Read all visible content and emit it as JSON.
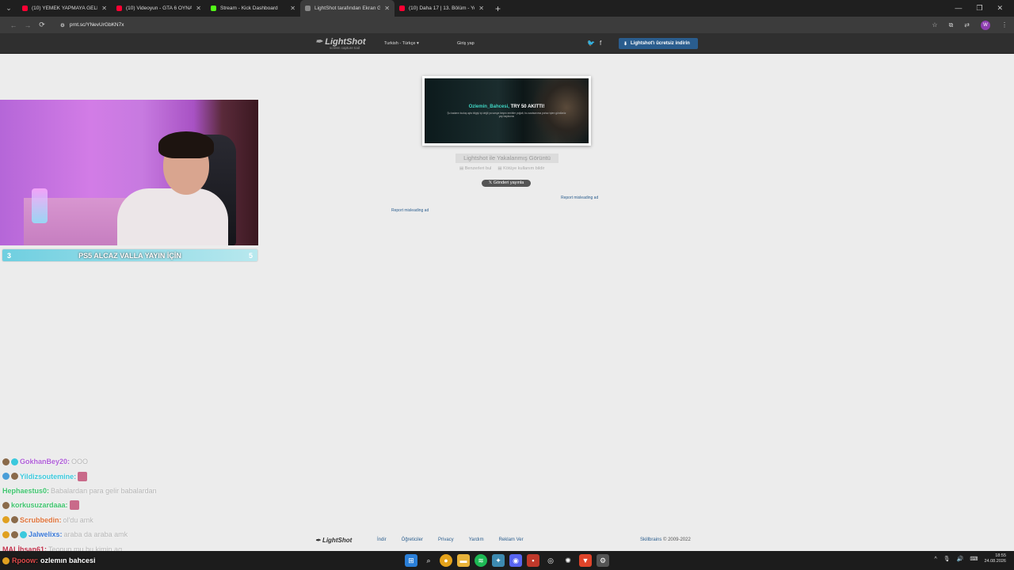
{
  "browser": {
    "tabs": [
      {
        "label": "(10) YEMEK YAPMAYA GELDİK...",
        "color": "#ff0033",
        "active": false
      },
      {
        "label": "(10) Videoyun - GTA 6 OYNANI...",
        "color": "#ff0033",
        "active": false
      },
      {
        "label": "Stream - Kick Dashboard",
        "color": "#53fc18",
        "active": false
      },
      {
        "label": "LightShot tarafından Ekran Gö...",
        "color": "#888888",
        "active": true
      },
      {
        "label": "(10) Daha 17 | 13. Bölüm - YouT...",
        "color": "#ff0033",
        "active": false
      }
    ],
    "url": "prnt.sc/YNevUrGbKN7x",
    "profile_initial": "W"
  },
  "lightshot": {
    "logo": "LightShot",
    "logo_sub": "screen capture tool",
    "language": "Turkish - Türkçe",
    "login": "Giriş yap",
    "download_button": "Lightshot'ı ücretsiz indirin",
    "screenshot": {
      "title_name": "Ozlemin_Bahcesi,",
      "title_rest": " TRY 50 AKITTI!",
      "text": "Şu kadarın kuduş ayla bilgiyi içi değil ya sarıya beşmı emiriler yoğalt, bu azatsanıma yurtaz işten gördünüz yay bayksırısı"
    },
    "caption": "Lightshot ile Yakalanmış Görüntü",
    "similar": "Benzerleri bul",
    "abuse": "Kötüye kullanım bildir",
    "tweet": "Gönderi yayınla",
    "report_ad_1": "Report misleading ad",
    "report_ad_2": "Report misleading ad",
    "footer": {
      "logo": "LightShot",
      "links": [
        "İndir",
        "Öğreticiler",
        "Privacy",
        "Yardım",
        "Reklam Ver"
      ],
      "company": "Skillbrains",
      "copyright": " © 2009-2022"
    }
  },
  "stream": {
    "goal_left": "3",
    "goal_text": "PS5 ALCAZ VALLA YAYIN İÇİN",
    "goal_right": "5",
    "chat": [
      {
        "user": "GokhanBey20:",
        "msg": "OOO",
        "color": "#b05fd8"
      },
      {
        "user": "Yildizsoutemine:",
        "msg": "",
        "color": "#3bc9dd"
      },
      {
        "user": "Hephaestus0:",
        "msg": "Babalardan para gelir babalardan",
        "color": "#3ec46d"
      },
      {
        "user": "korkusuzardaaa:",
        "msg": "",
        "color": "#3ec46d"
      },
      {
        "user": "Scrubbedin:",
        "msg": "ol'du amk",
        "color": "#e0733a"
      },
      {
        "user": "Jalwelixs:",
        "msg": "araba da araba amk",
        "color": "#3a79d8"
      },
      {
        "user": "MALİhsan61:",
        "msg": "Teonun mu bu kimin aq",
        "color": "#c0304a"
      }
    ],
    "banner_user": "Rpoow:",
    "banner_msg": "ozlemın bahcesi"
  },
  "taskbar": {
    "time": "18:55",
    "date": "24.08.2026"
  }
}
